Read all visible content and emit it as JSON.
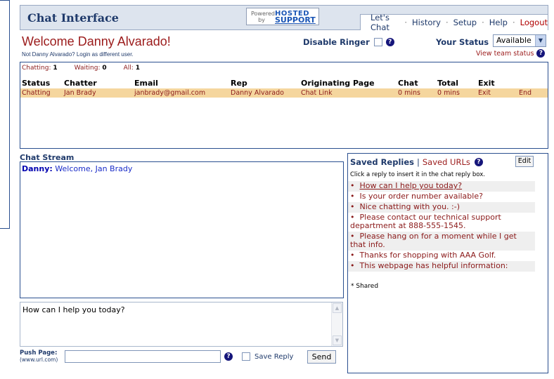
{
  "header": {
    "app_title": "Chat Interface",
    "powered_text": "Powered by",
    "logo_line1": "HOSTED",
    "logo_line2": "SUPPORT",
    "nav": [
      "Let's Chat",
      "History",
      "Setup",
      "Help",
      "Logout"
    ]
  },
  "user": {
    "welcome": "Welcome Danny Alvarado!",
    "not_user": "Not Danny Alvarado?",
    "login_link": "Login as different user."
  },
  "controls": {
    "disable_ringer": "Disable Ringer",
    "status_label": "Your Status",
    "status_value": "Available",
    "team_status": "View team status"
  },
  "queue": {
    "counts": [
      {
        "label": "Chatting:",
        "value": "1"
      },
      {
        "label": "Waiting:",
        "value": "0"
      },
      {
        "label": "All:",
        "value": "1"
      }
    ],
    "columns": [
      "Status",
      "Chatter",
      "Email",
      "Rep",
      "Originating Page",
      "Chat",
      "Total",
      "Exit",
      ""
    ],
    "rows": [
      [
        "Chatting",
        "Jan Brady",
        "janbrady@gmail.com",
        "Danny Alvarado",
        "Chat Link",
        "0 mins",
        "0 mins",
        "Exit",
        "End"
      ]
    ]
  },
  "stream": {
    "title": "Chat Stream",
    "messages": [
      {
        "sender": "Danny:",
        "text": "Welcome, Jan Brady"
      }
    ]
  },
  "compose": {
    "reply_text": "How can I help you today?",
    "push_label": "Push Page:",
    "push_hint": "(www.url.com)",
    "push_value": "",
    "save_reply": "Save Reply",
    "send": "Send"
  },
  "saved": {
    "title": "Saved Replies",
    "urls": "Saved URLs",
    "edit": "Edit",
    "info": "Click a reply to insert it in the chat reply box.",
    "bullet": "•",
    "replies": [
      "How can I help you today?",
      "Is your order number available?",
      "Nice chatting with you. :-)",
      "Please contact our technical support department at 888-555-1545.",
      "Please hang on for a moment while I get that info.",
      "Thanks for shopping with AAA Golf.",
      "This webpage has helpful information:"
    ],
    "shared_note": "* Shared"
  },
  "icons": {
    "help": "?",
    "chevron": "▼",
    "scroll_up": "▲",
    "scroll_down": "▼"
  }
}
